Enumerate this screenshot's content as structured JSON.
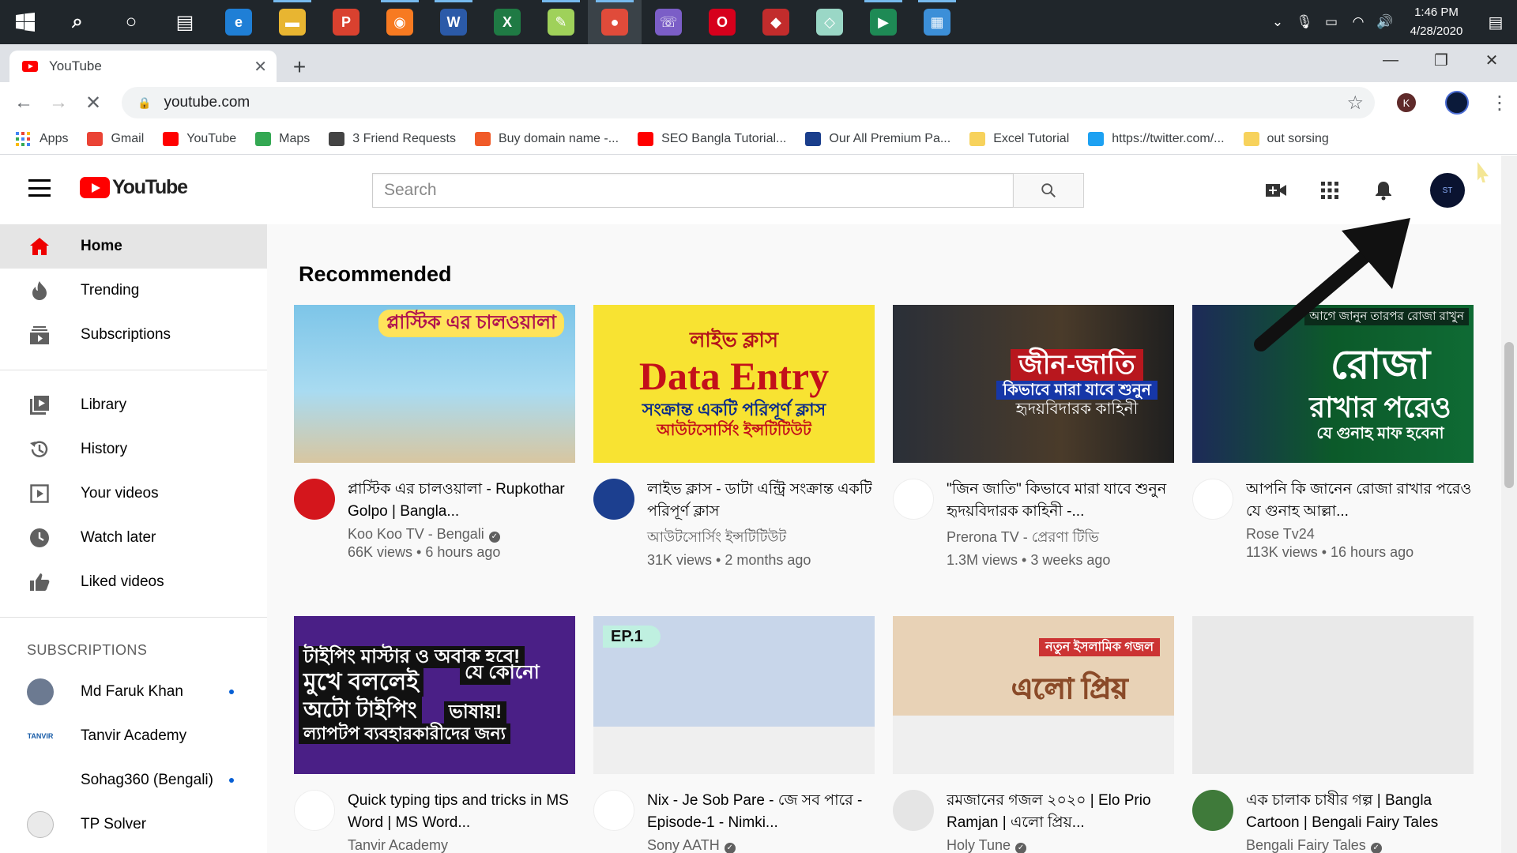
{
  "taskbar": {
    "apps": [
      {
        "name": "search",
        "glyph": "⌕",
        "color": "transparent"
      },
      {
        "name": "cortana",
        "glyph": "○",
        "color": "transparent"
      },
      {
        "name": "task-view",
        "glyph": "▤",
        "color": "transparent"
      },
      {
        "name": "edge",
        "glyph": "e",
        "color": "#1f7fd6"
      },
      {
        "name": "file-explorer",
        "glyph": "▬",
        "color": "#e8b531"
      },
      {
        "name": "pdf-app",
        "glyph": "P",
        "color": "#d9412f"
      },
      {
        "name": "firefox",
        "glyph": "◉",
        "color": "#f77a21"
      },
      {
        "name": "word",
        "glyph": "W",
        "color": "#2b5aa8"
      },
      {
        "name": "excel",
        "glyph": "X",
        "color": "#1f7a44"
      },
      {
        "name": "paint",
        "glyph": "✎",
        "color": "#9fd15a"
      },
      {
        "name": "chrome",
        "glyph": "●",
        "color": "#e04b3a"
      },
      {
        "name": "viber",
        "glyph": "☏",
        "color": "#7b5ec7"
      },
      {
        "name": "opera",
        "glyph": "O",
        "color": "#d6001c"
      },
      {
        "name": "app-red",
        "glyph": "◆",
        "color": "#c22c2c"
      },
      {
        "name": "app-gem",
        "glyph": "◇",
        "color": "#9ad7c6"
      },
      {
        "name": "app-green",
        "glyph": "▶",
        "color": "#1e8a55"
      },
      {
        "name": "photos",
        "glyph": "▦",
        "color": "#3c8fd8"
      }
    ],
    "time": "1:46 PM",
    "date": "4/28/2020"
  },
  "browser": {
    "tab_title": "YouTube",
    "url": "youtube.com",
    "bookmarks": [
      {
        "label": "Apps",
        "color": "#4285f4"
      },
      {
        "label": "Gmail",
        "color": "#ea4335"
      },
      {
        "label": "YouTube",
        "color": "#ff0000"
      },
      {
        "label": "Maps",
        "color": "#34a853"
      },
      {
        "label": "3 Friend Requests",
        "color": "#444444"
      },
      {
        "label": "Buy domain name -...",
        "color": "#f05a28"
      },
      {
        "label": "SEO Bangla Tutorial...",
        "color": "#ff0000"
      },
      {
        "label": "Our All Premium Pa...",
        "color": "#1a3e8c"
      },
      {
        "label": "Excel Tutorial",
        "color": "#f7d25c"
      },
      {
        "label": "https://twitter.com/...",
        "color": "#1da1f2"
      },
      {
        "label": "out sorsing",
        "color": "#f7d25c"
      }
    ]
  },
  "youtube": {
    "logo_text": "YouTube",
    "search_placeholder": "Search",
    "sidebar_primary": [
      {
        "label": "Home",
        "icon": "home-icon",
        "active": true
      },
      {
        "label": "Trending",
        "icon": "trending-icon"
      },
      {
        "label": "Subscriptions",
        "icon": "subscriptions-icon"
      }
    ],
    "sidebar_library": [
      {
        "label": "Library",
        "icon": "library-icon"
      },
      {
        "label": "History",
        "icon": "history-icon"
      },
      {
        "label": "Your videos",
        "icon": "your-videos-icon"
      },
      {
        "label": "Watch later",
        "icon": "watch-later-icon"
      },
      {
        "label": "Liked videos",
        "icon": "liked-videos-icon"
      }
    ],
    "subscriptions_heading": "SUBSCRIPTIONS",
    "subscriptions": [
      {
        "label": "Md Faruk Khan",
        "new": true,
        "color": "#6c7a91"
      },
      {
        "label": "Tanvir Academy",
        "new": false,
        "color": "#ffffff"
      },
      {
        "label": "Sohag360 (Bengali)",
        "new": true,
        "color": "#ffffff"
      },
      {
        "label": "TP Solver",
        "new": false,
        "color": "#eaeaea"
      }
    ],
    "section_title": "Recommended",
    "videos": [
      {
        "title": "প্লাস্টিক এর চালওয়ালা - Rupkothar Golpo | Bangla...",
        "channel": "Koo Koo TV - Bengali",
        "verified": true,
        "stats": "66K views • 6 hours ago",
        "thumb_text": [
          "প্লাস্টিক এর চালওয়ালা"
        ],
        "avatar_color": "#d4161c"
      },
      {
        "title": "লাইভ ক্লাস - ডাটা এন্ট্রি সংক্রান্ত একটি পরিপূর্ণ ক্লাস",
        "channel": "আউটসোর্সিং ইন্সটিটিউট",
        "verified": false,
        "stats": "31K views • 2 months ago",
        "thumb_text": [
          "লাইভ ক্লাস",
          "Data Entry",
          "সংক্রান্ত একটি পরিপূর্ণ ক্লাস",
          "আউটসোর্সিং ইন্সটিটিউট"
        ],
        "avatar_color": "#1c3f8f"
      },
      {
        "title": "\"জিন জাতি\" কিভাবে মারা যাবে শুনুন হৃদয়বিদারক কাহিনী -...",
        "channel": "Prerona TV - প্রেরণা টিভি",
        "verified": false,
        "stats": "1.3M views • 3 weeks ago",
        "thumb_text": [
          "জীন-জাতি",
          "কিভাবে মারা যাবে শুনুন",
          "হৃদয়বিদারক কাহিনী"
        ],
        "avatar_color": "#ffffff"
      },
      {
        "title": "আপনি কি জানেন রোজা রাখার পরেও যে গুনাহ আল্লা...",
        "channel": "Rose Tv24",
        "verified": false,
        "stats": "113K views • 16 hours ago",
        "thumb_text": [
          "আগে জানুন তারপর রোজা রাখুন",
          "রোজা",
          "রাখার পরেও",
          "যে গুনাহ মাফ হবেনা"
        ],
        "avatar_color": "#ffffff"
      },
      {
        "title": "Quick typing tips and tricks in MS Word | MS Word...",
        "channel": "Tanvir Academy",
        "verified": false,
        "stats": "",
        "thumb_text": [
          "টাইপিং মাস্টার ও অবাক হবে!",
          "মুখে বললেই",
          "যে কোনো",
          "অটো টাইপিং",
          "ভাষায়!",
          "ল্যাপটপ ব্যবহারকারীদের জন্য"
        ],
        "avatar_color": "#ffffff"
      },
      {
        "title": "Nix - Je Sob Pare - জে সব পারে - Episode-1 - Nimki...",
        "channel": "Sony AATH",
        "verified": true,
        "stats": "",
        "thumb_text": [
          "EP.1"
        ],
        "avatar_color": "#ffffff"
      },
      {
        "title": "রমজানের গজল ২০২০ | Elo Prio Ramjan | এলো প্রিয়...",
        "channel": "Holy Tune",
        "verified": true,
        "stats": "",
        "thumb_text": [
          "নতুন ইসলামিক গজল",
          "এলো প্রিয়"
        ],
        "avatar_color": "#e5e5e5"
      },
      {
        "title": "এক চালাক চাষীর গল্প | Bangla Cartoon | Bengali Fairy Tales",
        "channel": "Bengali Fairy Tales",
        "verified": true,
        "stats": "",
        "thumb_text": [],
        "avatar_color": "#3f7a3a"
      }
    ]
  },
  "colors": {
    "accent": "#ff0000",
    "taskbar": "#20262b",
    "link": "#065fd4"
  }
}
